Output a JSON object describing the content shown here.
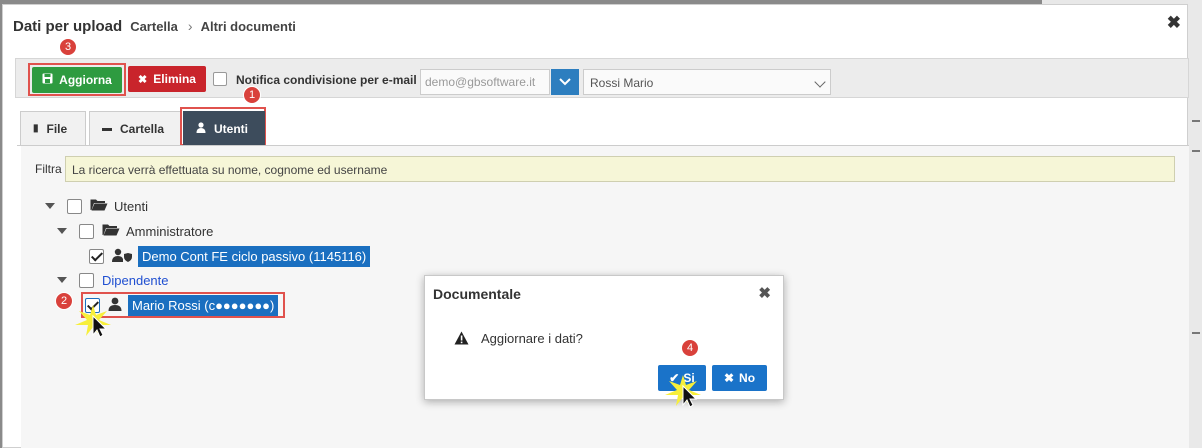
{
  "window": {
    "title": "Dati per upload",
    "breadcrumb": [
      "Cartella",
      "Altri documenti"
    ]
  },
  "toolbar": {
    "aggiorna_label": "Aggiorna",
    "elimina_label": "Elimina",
    "notify_label": "Notifica condivisione per e-mail",
    "email_placeholder": "demo@gbsoftware.it",
    "recipient_selected": "Rossi Mario"
  },
  "tabs": [
    {
      "label": "File",
      "active": false
    },
    {
      "label": "Cartella",
      "active": false
    },
    {
      "label": "Utenti",
      "active": true
    }
  ],
  "filter": {
    "label": "Filtra",
    "value": "La ricerca verrà effettuata su nome, cognome ed username"
  },
  "tree": {
    "root": "Utenti",
    "group_admin": "Amministratore",
    "admin_user": "Demo Cont FE ciclo passivo (1145116)",
    "group_employee": "Dipendente",
    "employee_user": "Mario Rossi (c●●●●●●●)"
  },
  "modal": {
    "title": "Documentale",
    "message": "Aggiornare i dati?",
    "yes_label": "Si",
    "no_label": "No"
  },
  "badges": [
    "1",
    "2",
    "3",
    "4"
  ],
  "colors": {
    "aggiorna": "#2e9b40",
    "elimina": "#c9242b",
    "active_tab": "#3d4c5c",
    "selected_item": "#1a6fc0",
    "highlight": "#e0524d"
  }
}
